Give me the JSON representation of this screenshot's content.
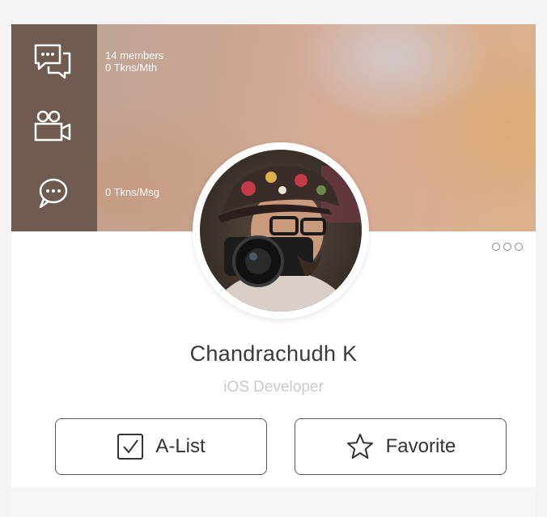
{
  "sidebar": {
    "icons": [
      "chat-bubbles-icon",
      "video-camera-icon",
      "speech-bubble-icon"
    ]
  },
  "stats": {
    "members": "14 members",
    "tokens_per_month": "0 Tkns/Mth",
    "tokens_per_message": "0 Tkns/Msg"
  },
  "profile": {
    "name": "Chandrachudh K",
    "role": "iOS Developer"
  },
  "actions": {
    "alist_label": "A-List",
    "favorite_label": "Favorite"
  },
  "colors": {
    "sidebar": "#6e5a4f",
    "text_dark": "#3a3a3a",
    "text_muted": "#c9c9c9",
    "button_border": "#5a5a5a"
  }
}
